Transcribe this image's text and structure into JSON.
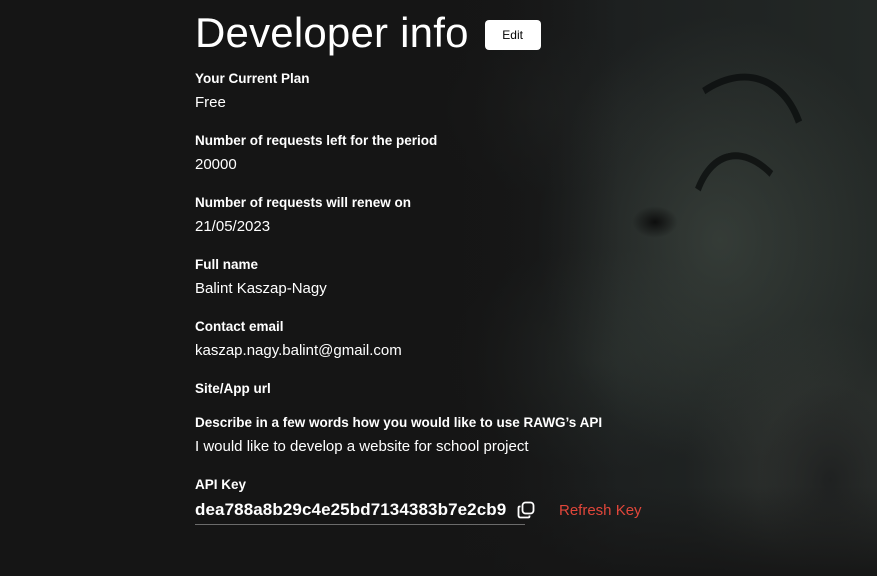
{
  "header": {
    "title": "Developer info",
    "edit_label": "Edit"
  },
  "fields": {
    "plan": {
      "label": "Your Current Plan",
      "value": "Free"
    },
    "requests_left": {
      "label": "Number of requests left for the period",
      "value": "20000"
    },
    "renew_date": {
      "label": "Number of requests will renew on",
      "value": "21/05/2023"
    },
    "full_name": {
      "label": "Full name",
      "value": "Balint Kaszap-Nagy"
    },
    "contact_email": {
      "label": "Contact email",
      "value": "kaszap.nagy.balint@gmail.com"
    },
    "site_url": {
      "label": "Site/App url",
      "value": ""
    },
    "usage": {
      "label": "Describe in a few words how you would like to use RAWG’s API",
      "value": "I would like to develop a website for school project"
    }
  },
  "api_key": {
    "label": "API Key",
    "value": "dea788a8b29c4e25bd7134383b7e2cb9",
    "copy_icon": "copy-icon",
    "refresh_label": "Refresh Key"
  },
  "colors": {
    "background": "#151515",
    "refresh_accent": "#e0463a",
    "button_bg": "#ffffff"
  }
}
